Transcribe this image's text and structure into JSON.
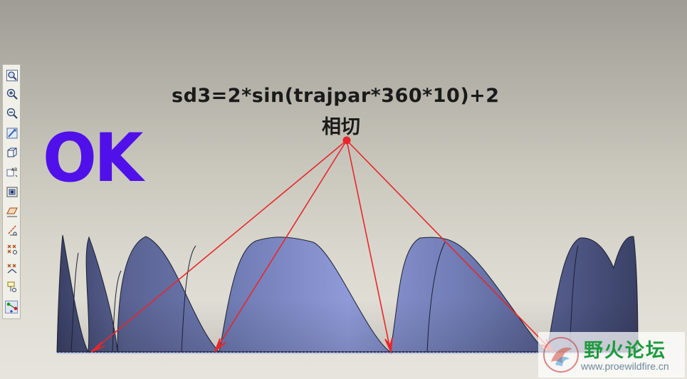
{
  "annotation": {
    "formula": "sd3=2*sin(trajpar*360*10)+2",
    "tangent_label": "相切",
    "ok_label": "OK",
    "ok_color": "#5010ea",
    "arrow_color": "#e8262b"
  },
  "toolbar": {
    "buttons": [
      {
        "icon": "zoom-fit-icon"
      },
      {
        "icon": "zoom-in-icon"
      },
      {
        "icon": "zoom-out-icon"
      },
      {
        "icon": "repaint-icon"
      },
      {
        "icon": "view-orientation-icon"
      },
      {
        "icon": "saved-views-icon",
        "text": "AB"
      },
      {
        "icon": "layers-icon"
      },
      {
        "icon": "datum-plane-display-icon"
      },
      {
        "icon": "datum-axis-display-icon"
      },
      {
        "icon": "datum-point-display-icon"
      },
      {
        "icon": "coordinate-system-display-icon"
      },
      {
        "icon": "annotation-display-icon"
      },
      {
        "icon": "spin-center-icon"
      }
    ]
  },
  "watermark": {
    "title": "野火论坛",
    "url": "www.proewildfire.cn"
  }
}
